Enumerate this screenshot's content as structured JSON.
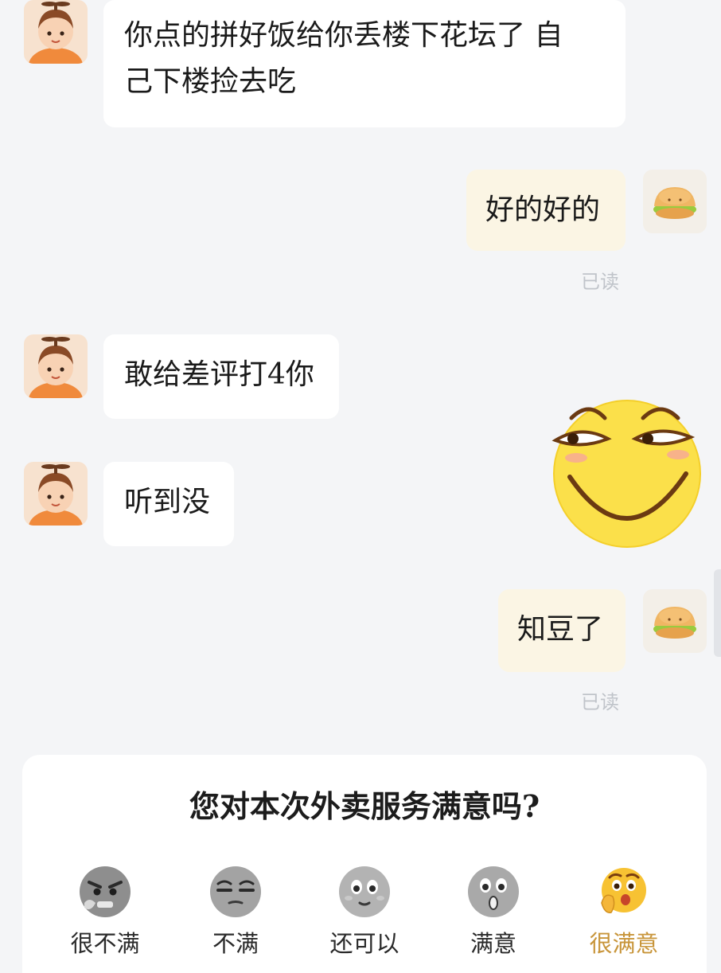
{
  "messages": [
    {
      "side": "in",
      "text_line1": "你点的拼好饭给你丢楼下花坛了 自",
      "text_line2": "己下楼捡去吃"
    },
    {
      "side": "out",
      "text": "好的好的",
      "status": "已读"
    },
    {
      "side": "in",
      "text": "敢给差评打4你"
    },
    {
      "side": "in",
      "text": "听到没"
    },
    {
      "side": "out",
      "text": "知豆了",
      "status": "已读"
    }
  ],
  "sticker": {
    "icon": "smirking-face-sticker"
  },
  "rating": {
    "question": "您对本次外卖服务满意吗?",
    "options": [
      {
        "label": "很不满",
        "icon": "angry-face-icon"
      },
      {
        "label": "不满",
        "icon": "unamused-face-icon"
      },
      {
        "label": "还可以",
        "icon": "neutral-face-icon"
      },
      {
        "label": "满意",
        "icon": "surprised-face-icon"
      },
      {
        "label": "很满意",
        "icon": "delighted-face-icon",
        "selected": true
      }
    ],
    "selected_color": "#c8953a"
  },
  "colors": {
    "background": "#f4f5f7",
    "incoming_bubble": "#ffffff",
    "outgoing_bubble": "#fbf5e4",
    "read_status": "#c0c4ca"
  }
}
